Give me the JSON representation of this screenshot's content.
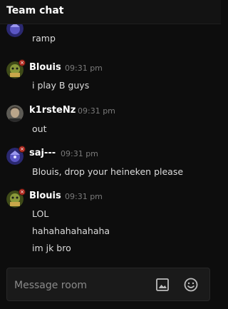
{
  "header": {
    "title": "Team chat"
  },
  "messages": [
    {
      "username": "",
      "timestamp": "",
      "lines": [
        "ramp"
      ],
      "avatar": {
        "icon": "purple-hero-avatar",
        "color": "#3c3a9a"
      }
    },
    {
      "username": "Blouis",
      "timestamp": "09:31 pm",
      "lines": [
        "i play B guys"
      ],
      "avatar": {
        "icon": "green-hero-avatar",
        "color": "#6b7a2a",
        "badge": "×"
      }
    },
    {
      "username": "k1rsteNz",
      "timestamp": "09:31 pm",
      "lines": [
        "out"
      ],
      "avatar": {
        "icon": "photo-avatar",
        "color": "#7d7b74"
      }
    },
    {
      "username": "saj---",
      "timestamp": "09:31 pm",
      "lines": [
        "Blouis, drop your heineken please"
      ],
      "avatar": {
        "icon": "purple-hero-avatar",
        "color": "#3c3a9a",
        "badge": "×"
      }
    },
    {
      "username": "Blouis",
      "timestamp": "09:31 pm",
      "lines": [
        "LOL",
        "hahahahahahaha",
        "im jk bro"
      ],
      "avatar": {
        "icon": "green-hero-avatar",
        "color": "#6b7a2a",
        "badge": "×"
      }
    }
  ],
  "composer": {
    "placeholder": "Message room",
    "image_icon": "image-icon",
    "emoji_icon": "emoji-icon"
  }
}
